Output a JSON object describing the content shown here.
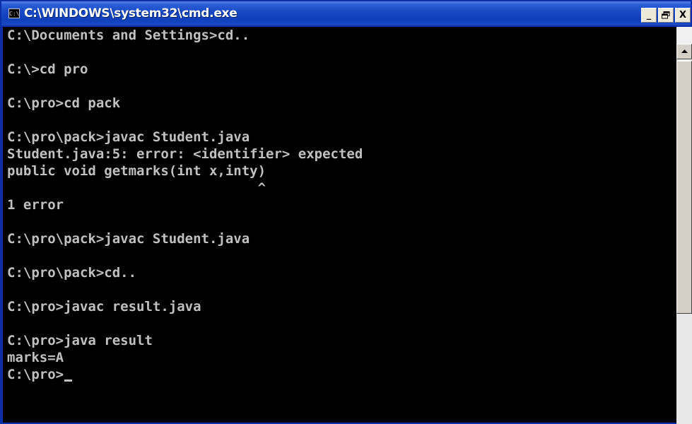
{
  "window": {
    "title": "C:\\WINDOWS\\system32\\cmd.exe",
    "icon_glyph": "C:\\",
    "buttons": {
      "minimize": "_",
      "maximize": "🗗",
      "close": "X"
    }
  },
  "console": {
    "lines": [
      "C:\\Documents and Settings>cd..",
      "",
      "C:\\>cd pro",
      "",
      "C:\\pro>cd pack",
      "",
      "C:\\pro\\pack>javac Student.java",
      "Student.java:5: error: <identifier> expected",
      "public void getmarks(int x,inty)",
      "                               ^",
      "1 error",
      "",
      "C:\\pro\\pack>javac Student.java",
      "",
      "C:\\pro\\pack>cd..",
      "",
      "C:\\pro>javac result.java",
      "",
      "C:\\pro>java result",
      "marks=A",
      "C:\\pro>"
    ]
  },
  "colors": {
    "console_bg": "#000000",
    "console_fg": "#c0c0c0",
    "titlebar": "#0f3fba"
  },
  "icons": {
    "app": "cmd-icon",
    "scroll_up": "scroll-up-arrow-icon"
  }
}
